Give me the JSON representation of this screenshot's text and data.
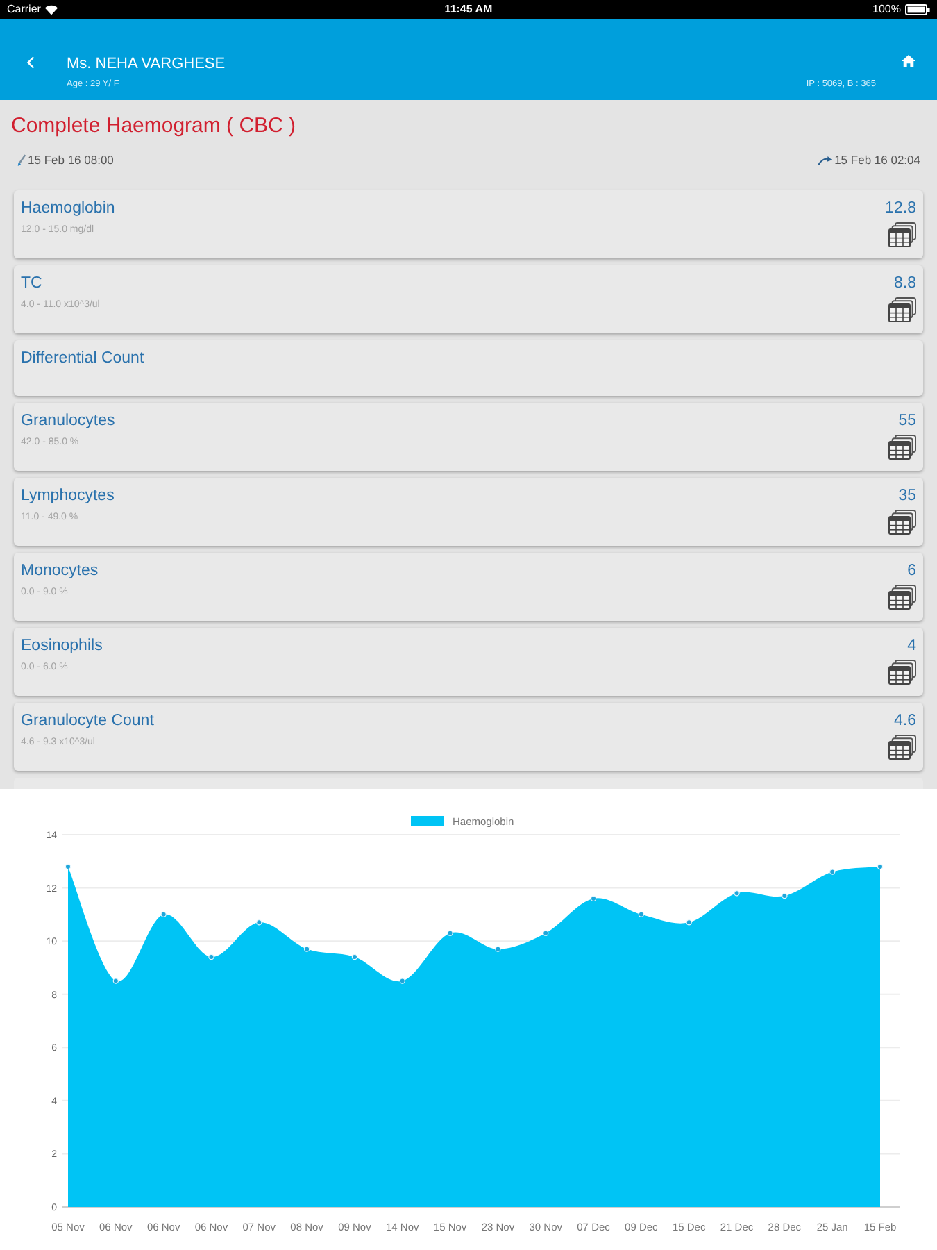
{
  "status_bar": {
    "carrier": "Carrier",
    "time": "11:45 AM",
    "battery": "100%"
  },
  "header": {
    "patient_name": "Ms. NEHA VARGHESE",
    "age_sex": "Age : 29 Y/ F",
    "admission": "IP : 5069, B : 365"
  },
  "report": {
    "title": "Complete Haemogram ( CBC )",
    "collected": "15 Feb 16 08:00",
    "reported": "15 Feb 16 02:04"
  },
  "results": [
    {
      "kind": "result",
      "name": "Haemoglobin",
      "range": "12.0 - 15.0 mg/dl",
      "value": "12.8"
    },
    {
      "kind": "result",
      "name": "TC",
      "range": "4.0 - 11.0 x10^3/ul",
      "value": "8.8"
    },
    {
      "kind": "section",
      "name": "Differential Count"
    },
    {
      "kind": "result",
      "name": "Granulocytes",
      "range": "42.0 - 85.0 %",
      "value": "55"
    },
    {
      "kind": "result",
      "name": "Lymphocytes",
      "range": "11.0 - 49.0 %",
      "value": "35"
    },
    {
      "kind": "result",
      "name": "Monocytes",
      "range": "0.0 - 9.0 %",
      "value": "6"
    },
    {
      "kind": "result",
      "name": "Eosinophils",
      "range": "0.0 - 6.0 %",
      "value": "4"
    },
    {
      "kind": "result",
      "name": "Granulocyte Count",
      "range": "4.6 - 9.3 x10^3/ul",
      "value": "4.6"
    }
  ],
  "chart": {
    "chart_data": {
      "type": "area",
      "categories": [
        "05 Nov",
        "06 Nov",
        "06 Nov",
        "06 Nov",
        "07 Nov",
        "08 Nov",
        "09 Nov",
        "14 Nov",
        "15 Nov",
        "23 Nov",
        "30 Nov",
        "07 Dec",
        "09 Dec",
        "15 Dec",
        "21 Dec",
        "28 Dec",
        "25 Jan",
        "15 Feb"
      ],
      "series": [
        {
          "name": "Haemoglobin",
          "color": "#00c4f5",
          "values": [
            12.8,
            8.5,
            11.0,
            9.4,
            10.7,
            9.7,
            9.4,
            8.5,
            10.3,
            9.7,
            10.3,
            11.6,
            11.0,
            10.7,
            11.8,
            11.7,
            12.6,
            12.8
          ]
        }
      ],
      "ylim": [
        0,
        14
      ],
      "yticks": [
        0,
        2,
        4,
        6,
        8,
        10,
        12,
        14
      ],
      "grid": true
    }
  }
}
